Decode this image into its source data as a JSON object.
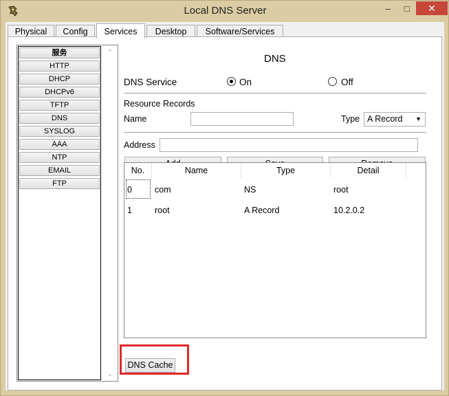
{
  "window": {
    "title": "Local DNS Server"
  },
  "tabs": [
    {
      "label": "Physical"
    },
    {
      "label": "Config"
    },
    {
      "label": "Services"
    },
    {
      "label": "Desktop"
    },
    {
      "label": "Software/Services"
    }
  ],
  "active_tab": "Services",
  "services": [
    {
      "label": "服务"
    },
    {
      "label": "HTTP"
    },
    {
      "label": "DHCP"
    },
    {
      "label": "DHCPv6"
    },
    {
      "label": "TFTP"
    },
    {
      "label": "DNS"
    },
    {
      "label": "SYSLOG"
    },
    {
      "label": "AAA"
    },
    {
      "label": "NTP"
    },
    {
      "label": "EMAIL"
    },
    {
      "label": "FTP"
    }
  ],
  "dns": {
    "heading": "DNS",
    "service_label": "DNS Service",
    "on_label": "On",
    "off_label": "Off",
    "selected": "On",
    "records_label": "Resource Records",
    "name_label": "Name",
    "name_value": "",
    "type_label": "Type",
    "type_value": "A Record",
    "address_label": "Address",
    "address_value": "",
    "add_button": "Add",
    "save_button": "Save",
    "remove_button": "Remove",
    "cache_button": "DNS Cache"
  },
  "table": {
    "columns": [
      "No.",
      "Name",
      "Type",
      "Detail"
    ],
    "rows": [
      {
        "no": "0",
        "name": "com",
        "type": "NS",
        "detail": "root"
      },
      {
        "no": "1",
        "name": "root",
        "type": "A Record",
        "detail": "10.2.0.2"
      }
    ]
  }
}
